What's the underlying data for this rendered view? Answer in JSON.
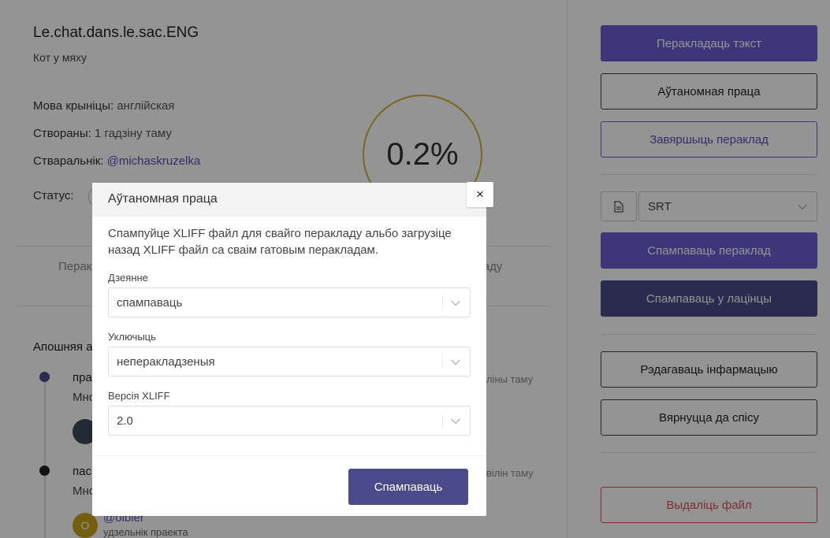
{
  "project": {
    "title": "Le.chat.dans.le.sac.ENG",
    "subtitle": "Кот у мяху",
    "source_label": "Мова крыніцы:",
    "source_value": "англійская",
    "created_label": "Створаны:",
    "created_value": "1 гадзіну таму",
    "creator_label": "Стваральнік:",
    "creator_value": "@michaskruzelka",
    "status_label": "Статус:",
    "progress": "0.2%"
  },
  "tabs": {
    "left_fragment": "Перак",
    "right_fragment": "ладу"
  },
  "activity": {
    "heading": "Апошняя а",
    "items": [
      {
        "title": "пра",
        "sub": "Мно",
        "time": "ліны таму"
      },
      {
        "title": "пас",
        "sub": "Мно",
        "time": "вілін таму"
      }
    ],
    "user": {
      "initial": "O",
      "handle": "@olbier",
      "role": "удзельнік праекта"
    }
  },
  "sidebar": {
    "translate_text": "Перакладаць тэкст",
    "offline_work": "Аўтаномная праца",
    "finish_translation": "Завяршыць пераклад",
    "format_value": "SRT",
    "download_translation": "Спампаваць пераклад",
    "download_latin": "Спампаваць у лацінцы",
    "edit_info": "Рэдагаваць інфармацыю",
    "back_to_list": "Вярнуцца да спісу",
    "delete_file": "Выдаліць файл"
  },
  "modal": {
    "title": "Аўтаномная праца",
    "close": "×",
    "description": "Спампуйце XLIFF файл для свайго перакладу альбо загрузіце назад XLIFF файл са сваім гатовым перакладам.",
    "action_label": "Дзеянне",
    "action_value": "спампаваць",
    "include_label": "Уключыць",
    "include_value": "неперакладзеныя",
    "version_label": "Версія XLIFF",
    "version_value": "2.0",
    "submit": "Спампаваць"
  },
  "colors": {
    "primary": "#6a5fd0",
    "dark": "#4a4a8a",
    "danger": "#d8505a",
    "progress_ring": "#d4b23a"
  }
}
